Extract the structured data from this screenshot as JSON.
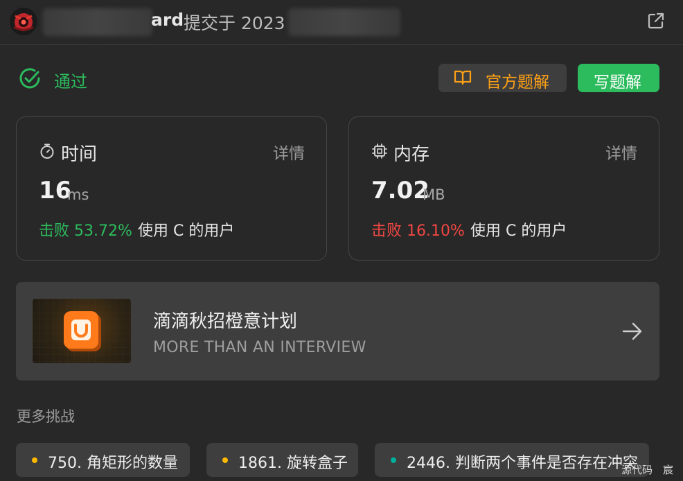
{
  "header": {
    "name_visible": "ard",
    "submitted_prefix": "提交于 2023"
  },
  "status": {
    "label": "通过",
    "color": "#2cbb5d"
  },
  "actions": {
    "official_solution": "官方题解",
    "write_solution": "写题解"
  },
  "runtime": {
    "title": "时间",
    "detail": "详情",
    "value": "16",
    "unit": "ms",
    "beat_label": "击败 53.72%",
    "beat_color": "#2cbb5d",
    "suffix": "使用 C 的用户"
  },
  "memory": {
    "title": "内存",
    "detail": "详情",
    "value": "7.02",
    "unit": "MB",
    "beat_label": "击败 16.10%",
    "beat_color": "#ef4743",
    "suffix": "使用 C 的用户"
  },
  "banner": {
    "title": "滴滴秋招橙意计划",
    "subtitle": "MORE THAN AN INTERVIEW",
    "logo": "didi-logo"
  },
  "more": {
    "title": "更多挑战",
    "items": [
      {
        "label": "750. 角矩形的数量",
        "dot_color": "#ffb800"
      },
      {
        "label": "1861. 旋转盒子",
        "dot_color": "#ffb800"
      },
      {
        "label": "2446. 判断两个事件是否存在冲突",
        "dot_color": "#00af9b"
      }
    ]
  },
  "watermark": "源代码　宸"
}
